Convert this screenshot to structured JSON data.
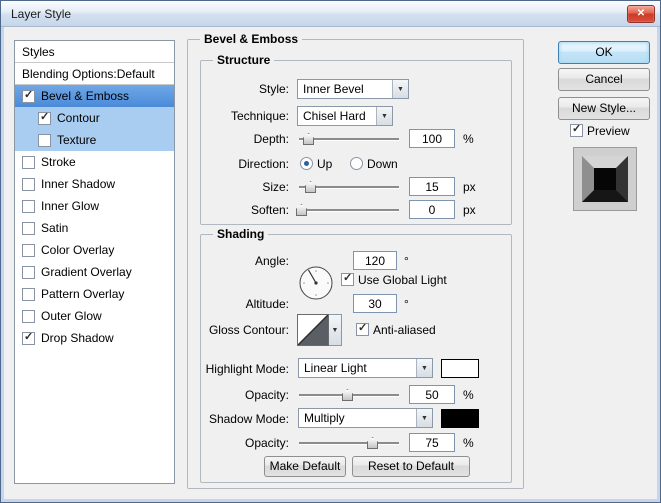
{
  "icons": {
    "check": "✓",
    "dropdown": "▼",
    "close": "✕"
  },
  "window": {
    "title": "Layer Style"
  },
  "sidebar": {
    "items": [
      {
        "label": "Styles"
      },
      {
        "label": "Blending Options:Default"
      },
      {
        "label": "Bevel & Emboss",
        "checked": true,
        "selected": true
      },
      {
        "label": "Contour",
        "checked": true
      },
      {
        "label": "Texture",
        "checked": false
      },
      {
        "label": "Stroke",
        "checked": false
      },
      {
        "label": "Inner Shadow",
        "checked": false
      },
      {
        "label": "Inner Glow",
        "checked": false
      },
      {
        "label": "Satin",
        "checked": false
      },
      {
        "label": "Color Overlay",
        "checked": false
      },
      {
        "label": "Gradient Overlay",
        "checked": false
      },
      {
        "label": "Pattern Overlay",
        "checked": false
      },
      {
        "label": "Outer Glow",
        "checked": false
      },
      {
        "label": "Drop Shadow",
        "checked": true
      }
    ]
  },
  "panel": {
    "title": "Bevel & Emboss",
    "structure": {
      "legend": "Structure",
      "style": {
        "label": "Style:",
        "value": "Inner Bevel"
      },
      "technique": {
        "label": "Technique:",
        "value": "Chisel Hard"
      },
      "depth": {
        "label": "Depth:",
        "value": "100",
        "unit": "%",
        "pos": 10
      },
      "direction": {
        "label": "Direction:",
        "up": "Up",
        "down": "Down",
        "selected": "Up"
      },
      "size": {
        "label": "Size:",
        "value": "15",
        "unit": "px",
        "pos": 12
      },
      "soften": {
        "label": "Soften:",
        "value": "0",
        "unit": "px",
        "pos": 3
      }
    },
    "shading": {
      "legend": "Shading",
      "angle": {
        "label": "Angle:",
        "value": "120",
        "unit": "°"
      },
      "use_global_light": {
        "label": "Use Global Light",
        "checked": true
      },
      "altitude": {
        "label": "Altitude:",
        "value": "30",
        "unit": "°"
      },
      "gloss_contour": {
        "label": "Gloss Contour:"
      },
      "anti_aliased": {
        "label": "Anti-aliased",
        "checked": true
      },
      "highlight_mode": {
        "label": "Highlight Mode:",
        "value": "Linear Light",
        "color": "#ffffff"
      },
      "highlight_opacity": {
        "label": "Opacity:",
        "value": "50",
        "unit": "%",
        "pos": 49
      },
      "shadow_mode": {
        "label": "Shadow Mode:",
        "value": "Multiply",
        "color": "#000000"
      },
      "shadow_opacity": {
        "label": "Opacity:",
        "value": "75",
        "unit": "%",
        "pos": 74
      },
      "make_default": "Make Default",
      "reset_to_default": "Reset to Default"
    }
  },
  "actions": {
    "ok": "OK",
    "cancel": "Cancel",
    "new_style": "New Style...",
    "preview": "Preview"
  }
}
